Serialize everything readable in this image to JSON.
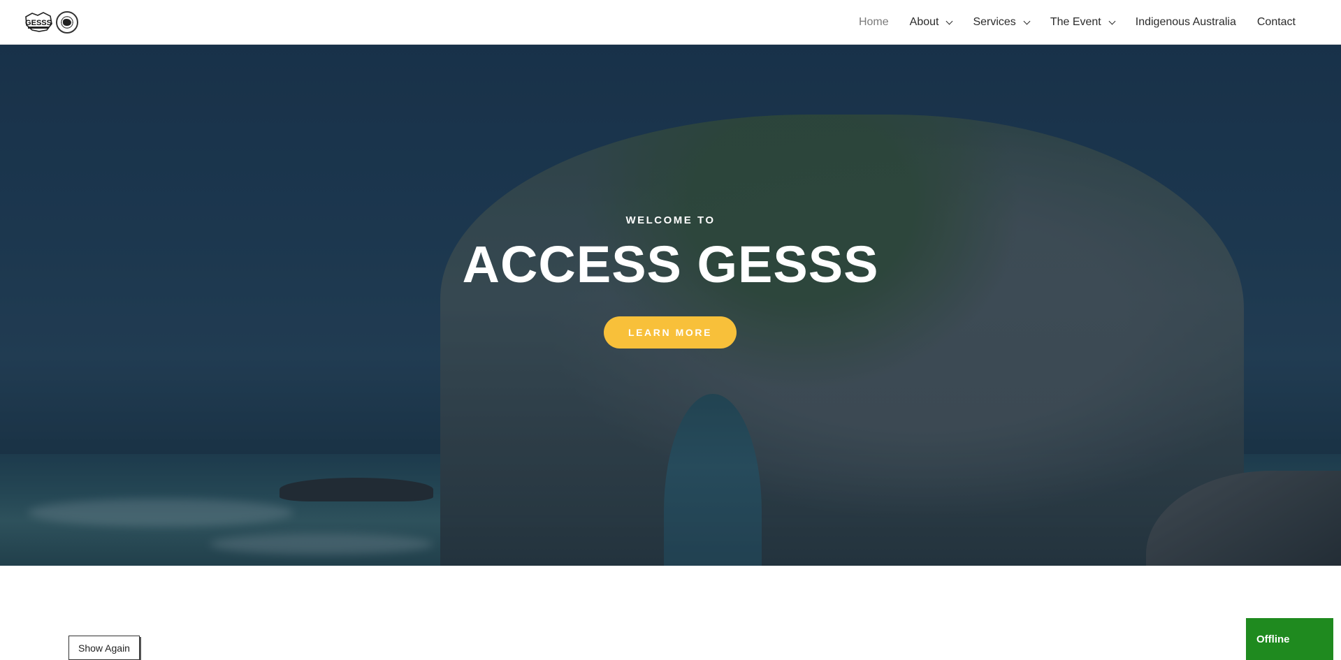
{
  "header": {
    "logo_text": "GESSS",
    "nav": {
      "home": "Home",
      "about": "About",
      "services": "Services",
      "the_event": "The Event",
      "indigenous": "Indigenous Australia",
      "contact": "Contact"
    }
  },
  "hero": {
    "eyebrow": "WELCOME TO",
    "title": "ACCESS GESSS",
    "cta_label": "LEARN MORE"
  },
  "widgets": {
    "show_again": "Show Again",
    "status": "Offline"
  },
  "colors": {
    "accent": "#f8c03a",
    "status_green": "#1f8a1f",
    "nav_active": "#7a7a7a",
    "nav_text": "#2b2b2b"
  },
  "icons": {
    "logo": "gesss-logo-icon",
    "seal": "australia-seal-icon",
    "dropdown": "chevron-down-icon"
  }
}
